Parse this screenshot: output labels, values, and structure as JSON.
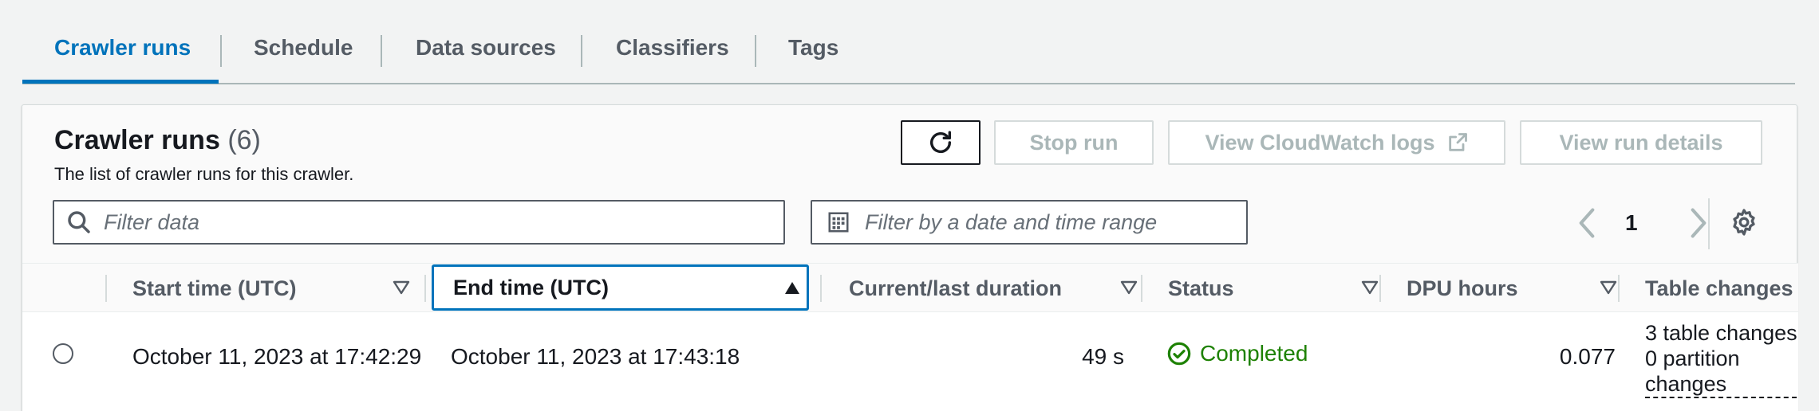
{
  "tabs": [
    {
      "label": "Crawler runs",
      "active": true
    },
    {
      "label": "Schedule",
      "active": false
    },
    {
      "label": "Data sources",
      "active": false
    },
    {
      "label": "Classifiers",
      "active": false
    },
    {
      "label": "Tags",
      "active": false
    }
  ],
  "panel": {
    "title": "Crawler runs",
    "count": "(6)",
    "description": "The list of crawler runs for this crawler.",
    "buttons": {
      "refresh_icon": "refresh-icon",
      "stop_run": "Stop run",
      "view_logs": "View CloudWatch logs",
      "view_logs_icon": "external-link-icon",
      "view_details": "View run details"
    },
    "filter": {
      "placeholder": "Filter data",
      "icon": "search-icon"
    },
    "date_filter": {
      "placeholder": "Filter by a date and time range",
      "icon": "calendar-icon"
    },
    "pagination": {
      "current_page": "1"
    }
  },
  "table": {
    "columns": [
      {
        "label": "Start time (UTC)"
      },
      {
        "label": "End time (UTC)",
        "sorted": "ascending"
      },
      {
        "label": "Current/last duration"
      },
      {
        "label": "Status"
      },
      {
        "label": "DPU hours"
      },
      {
        "label": "Table changes"
      }
    ],
    "rows": [
      {
        "start_time": "October 11, 2023 at 17:42:29",
        "end_time": "October 11, 2023 at 17:43:18",
        "duration": "49 s",
        "status": "Completed",
        "dpu_hours": "0.077",
        "table_changes_line1": "3 table changes,",
        "table_changes_line2": "0 partition",
        "table_changes_line3": "changes"
      }
    ]
  },
  "colors": {
    "accent": "#0073bb",
    "success": "#1d8102",
    "disabled": "#aab7b8"
  }
}
